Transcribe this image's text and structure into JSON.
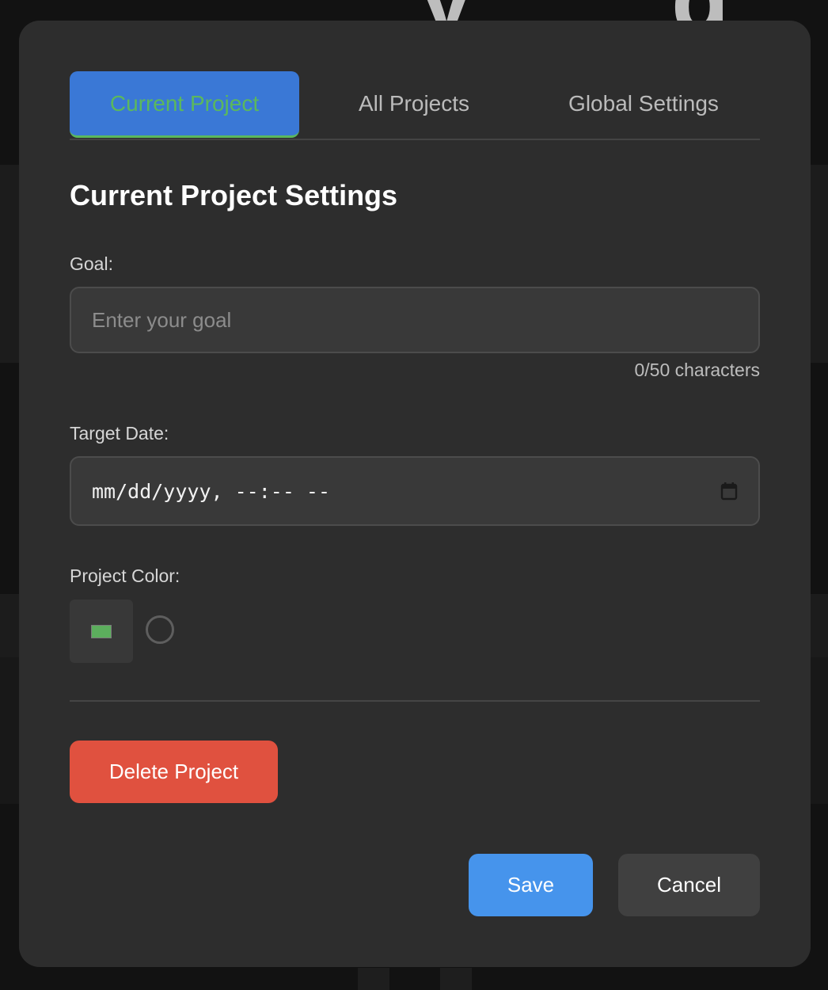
{
  "tabs": [
    {
      "label": "Current Project",
      "active": true
    },
    {
      "label": "All Projects",
      "active": false
    },
    {
      "label": "Global Settings",
      "active": false
    }
  ],
  "section_title": "Current Project Settings",
  "goal": {
    "label": "Goal:",
    "value": "",
    "placeholder": "Enter your goal",
    "counter": "0/50 characters"
  },
  "target_date": {
    "label": "Target Date:",
    "display": "mm/dd/yyyy, --:-- --",
    "icon": "calendar-icon"
  },
  "project_color": {
    "label": "Project Color:",
    "selected_color": "#5cae5d"
  },
  "buttons": {
    "delete": "Delete Project",
    "save": "Save",
    "cancel": "Cancel"
  },
  "colors": {
    "tab_active_bg": "#3a78d6",
    "tab_active_text": "#5bb85d",
    "delete": "#e0513f",
    "save": "#4694ec",
    "cancel": "#404040",
    "modal_bg": "#2d2d2d"
  }
}
